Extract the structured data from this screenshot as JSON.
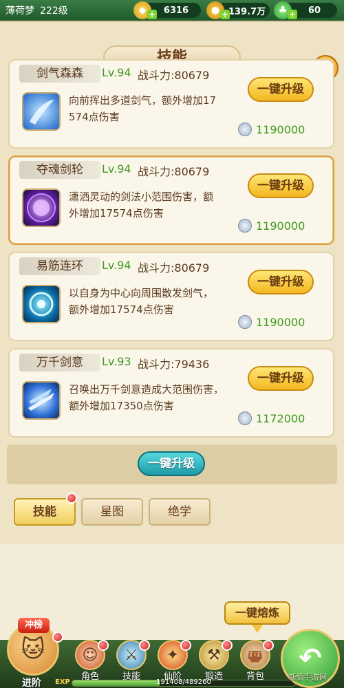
{
  "topbar": {
    "player_name": "薄荷梦",
    "player_level": "222级",
    "gold": "6316",
    "coins": "139.7万",
    "jade": "60"
  },
  "panel": {
    "title": "技能",
    "close": "✕"
  },
  "skills": [
    {
      "name": "剑气森森",
      "level": "Lv.94",
      "power": "战斗力:80679",
      "desc_line1": "向前挥出多道剑气，额外增加17",
      "desc_line2": "574点伤害",
      "button": "一键升级",
      "cost": "1190000"
    },
    {
      "name": "夺魂剑轮",
      "level": "Lv.94",
      "power": "战斗力:80679",
      "desc_line1": "潇洒灵动的剑法小范围伤害，额",
      "desc_line2": "外增加17574点伤害",
      "button": "一键升级",
      "cost": "1190000"
    },
    {
      "name": "易筋连环",
      "level": "Lv.94",
      "power": "战斗力:80679",
      "desc_line1": "以自身为中心向周围散发剑气，",
      "desc_line2": "额外增加17574点伤害",
      "button": "一键升级",
      "cost": "1190000"
    },
    {
      "name": "万千剑意",
      "level": "Lv.93",
      "power": "战斗力:79436",
      "desc_line1": "召唤出万千剑意造成大范围伤害，",
      "desc_line2": "额外增加17350点伤害",
      "button": "一键升级",
      "cost": "1172000"
    }
  ],
  "all_upgrade": "一键升级",
  "tabs": [
    "技能",
    "星图",
    "绝学"
  ],
  "forge": "一键熔炼",
  "nav": {
    "rank": "冲榜",
    "advance": "进阶",
    "items": [
      "角色",
      "技能",
      "仙阶",
      "锻造",
      "背包"
    ],
    "exp_tag": "EXP",
    "exp_text": "191408/489260",
    "exp_fraction": 0.391
  },
  "watermark": "新侨手游网",
  "colors": {
    "accent_green": "#3b9a1d",
    "gold": "#f4b721",
    "teal": "#1d9aa6"
  }
}
